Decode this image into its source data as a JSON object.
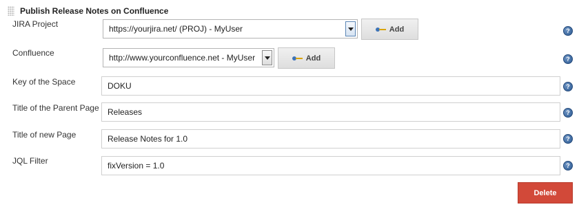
{
  "section": {
    "title": "Publish Release Notes on Confluence"
  },
  "fields": {
    "jira_project": {
      "label": "JIRA Project",
      "value": "https://yourjira.net/ (PROJ) - MyUser",
      "add_label": "Add"
    },
    "confluence": {
      "label": "Confluence",
      "value": "http://www.yourconfluence.net - MyUser",
      "add_label": "Add"
    },
    "space_key": {
      "label": "Key of the Space",
      "value": "DOKU"
    },
    "parent_page": {
      "label": "Title of the Parent Page",
      "value": "Releases"
    },
    "new_page": {
      "label": "Title of new Page",
      "value": "Release Notes for 1.0"
    },
    "jql_filter": {
      "label": "JQL Filter",
      "value": "fixVersion = 1.0"
    }
  },
  "help_glyph": "?",
  "actions": {
    "delete_label": "Delete"
  },
  "colors": {
    "delete_button": "#d24939",
    "help_icon": "#2b5a93"
  }
}
